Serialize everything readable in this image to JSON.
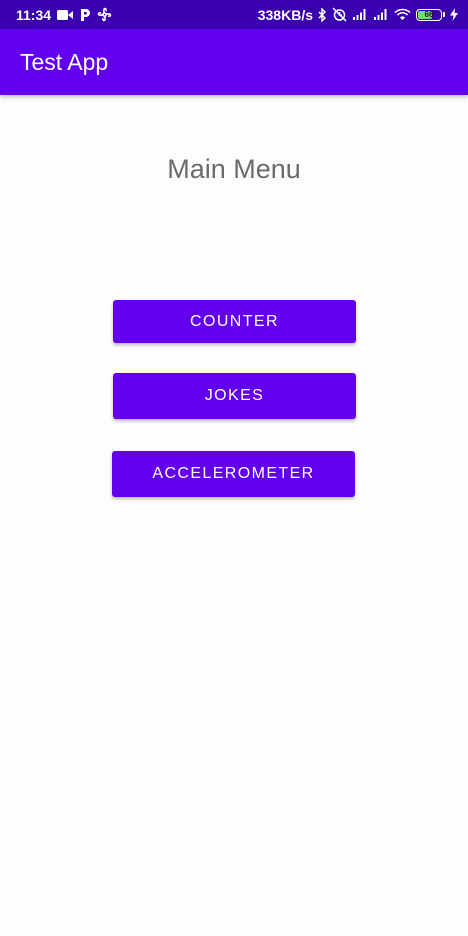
{
  "status_bar": {
    "time": "11:34",
    "speed": "338KB/s",
    "battery_level": "66",
    "battery_fraction": 0.66,
    "left_icons": [
      "video-camera-icon",
      "parking-app-icon",
      "fan-app-icon"
    ],
    "right_icons": [
      "bluetooth-icon",
      "alarm-off-icon",
      "signal-icon",
      "signal-icon",
      "wifi-icon",
      "battery-icon",
      "charging-bolt-icon"
    ]
  },
  "app_bar": {
    "title": "Test App",
    "color": "#6200ee"
  },
  "main": {
    "title": "Main Menu",
    "buttons": [
      {
        "label": "COUNTER"
      },
      {
        "label": "JOKES"
      },
      {
        "label": "ACCELEROMETER"
      }
    ]
  },
  "colors": {
    "status_bar": "#3b00b0",
    "primary": "#6200ee",
    "background": "#fdfdfd",
    "title_text": "#6b6b6b"
  }
}
